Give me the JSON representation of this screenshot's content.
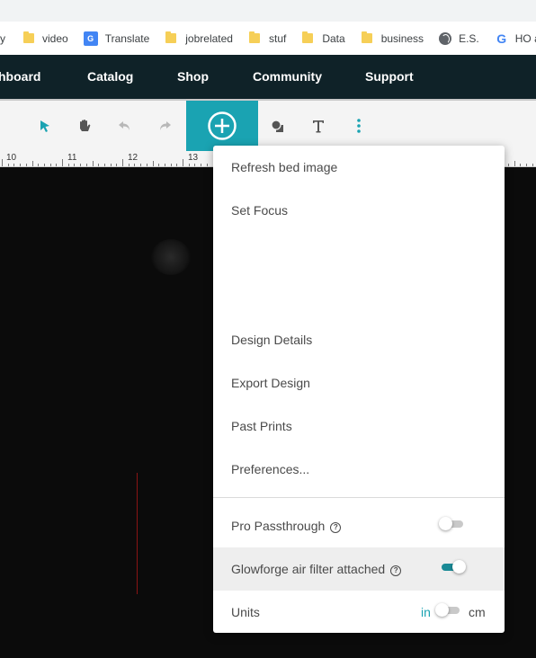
{
  "bookmarks": [
    {
      "label": "y",
      "icon": "none"
    },
    {
      "label": "video",
      "icon": "folder-icon"
    },
    {
      "label": "Translate",
      "icon": "google-translate-icon"
    },
    {
      "label": "jobrelated",
      "icon": "folder-icon"
    },
    {
      "label": "stuf",
      "icon": "folder-icon"
    },
    {
      "label": "Data",
      "icon": "folder-icon"
    },
    {
      "label": "business",
      "icon": "folder-icon"
    },
    {
      "label": "E.S.",
      "icon": "globe-icon"
    },
    {
      "label": "HO ap",
      "icon": "google-icon"
    }
  ],
  "nav": {
    "items": [
      "hboard",
      "Catalog",
      "Shop",
      "Community",
      "Support"
    ],
    "background": "#0f2228"
  },
  "toolbar": {
    "tools": [
      "select-arrow-icon",
      "hand-pan-icon",
      "undo-icon",
      "redo-icon",
      "add-circle-icon",
      "shapes-icon",
      "text-icon",
      "more-vertical-icon"
    ],
    "accent": "#1aa3b2"
  },
  "ruler": {
    "labels": [
      "10",
      "11",
      "12",
      "13"
    ]
  },
  "menu": {
    "items": [
      "Refresh bed image",
      "Set Focus",
      "Design Details",
      "Export Design",
      "Past Prints",
      "Preferences..."
    ],
    "pro_passthrough": {
      "label": "Pro Passthrough",
      "enabled": false
    },
    "air_filter": {
      "label": "Glowforge air filter attached",
      "enabled": true
    },
    "units": {
      "label": "Units",
      "left": "in",
      "right": "cm",
      "selected": "in"
    }
  }
}
